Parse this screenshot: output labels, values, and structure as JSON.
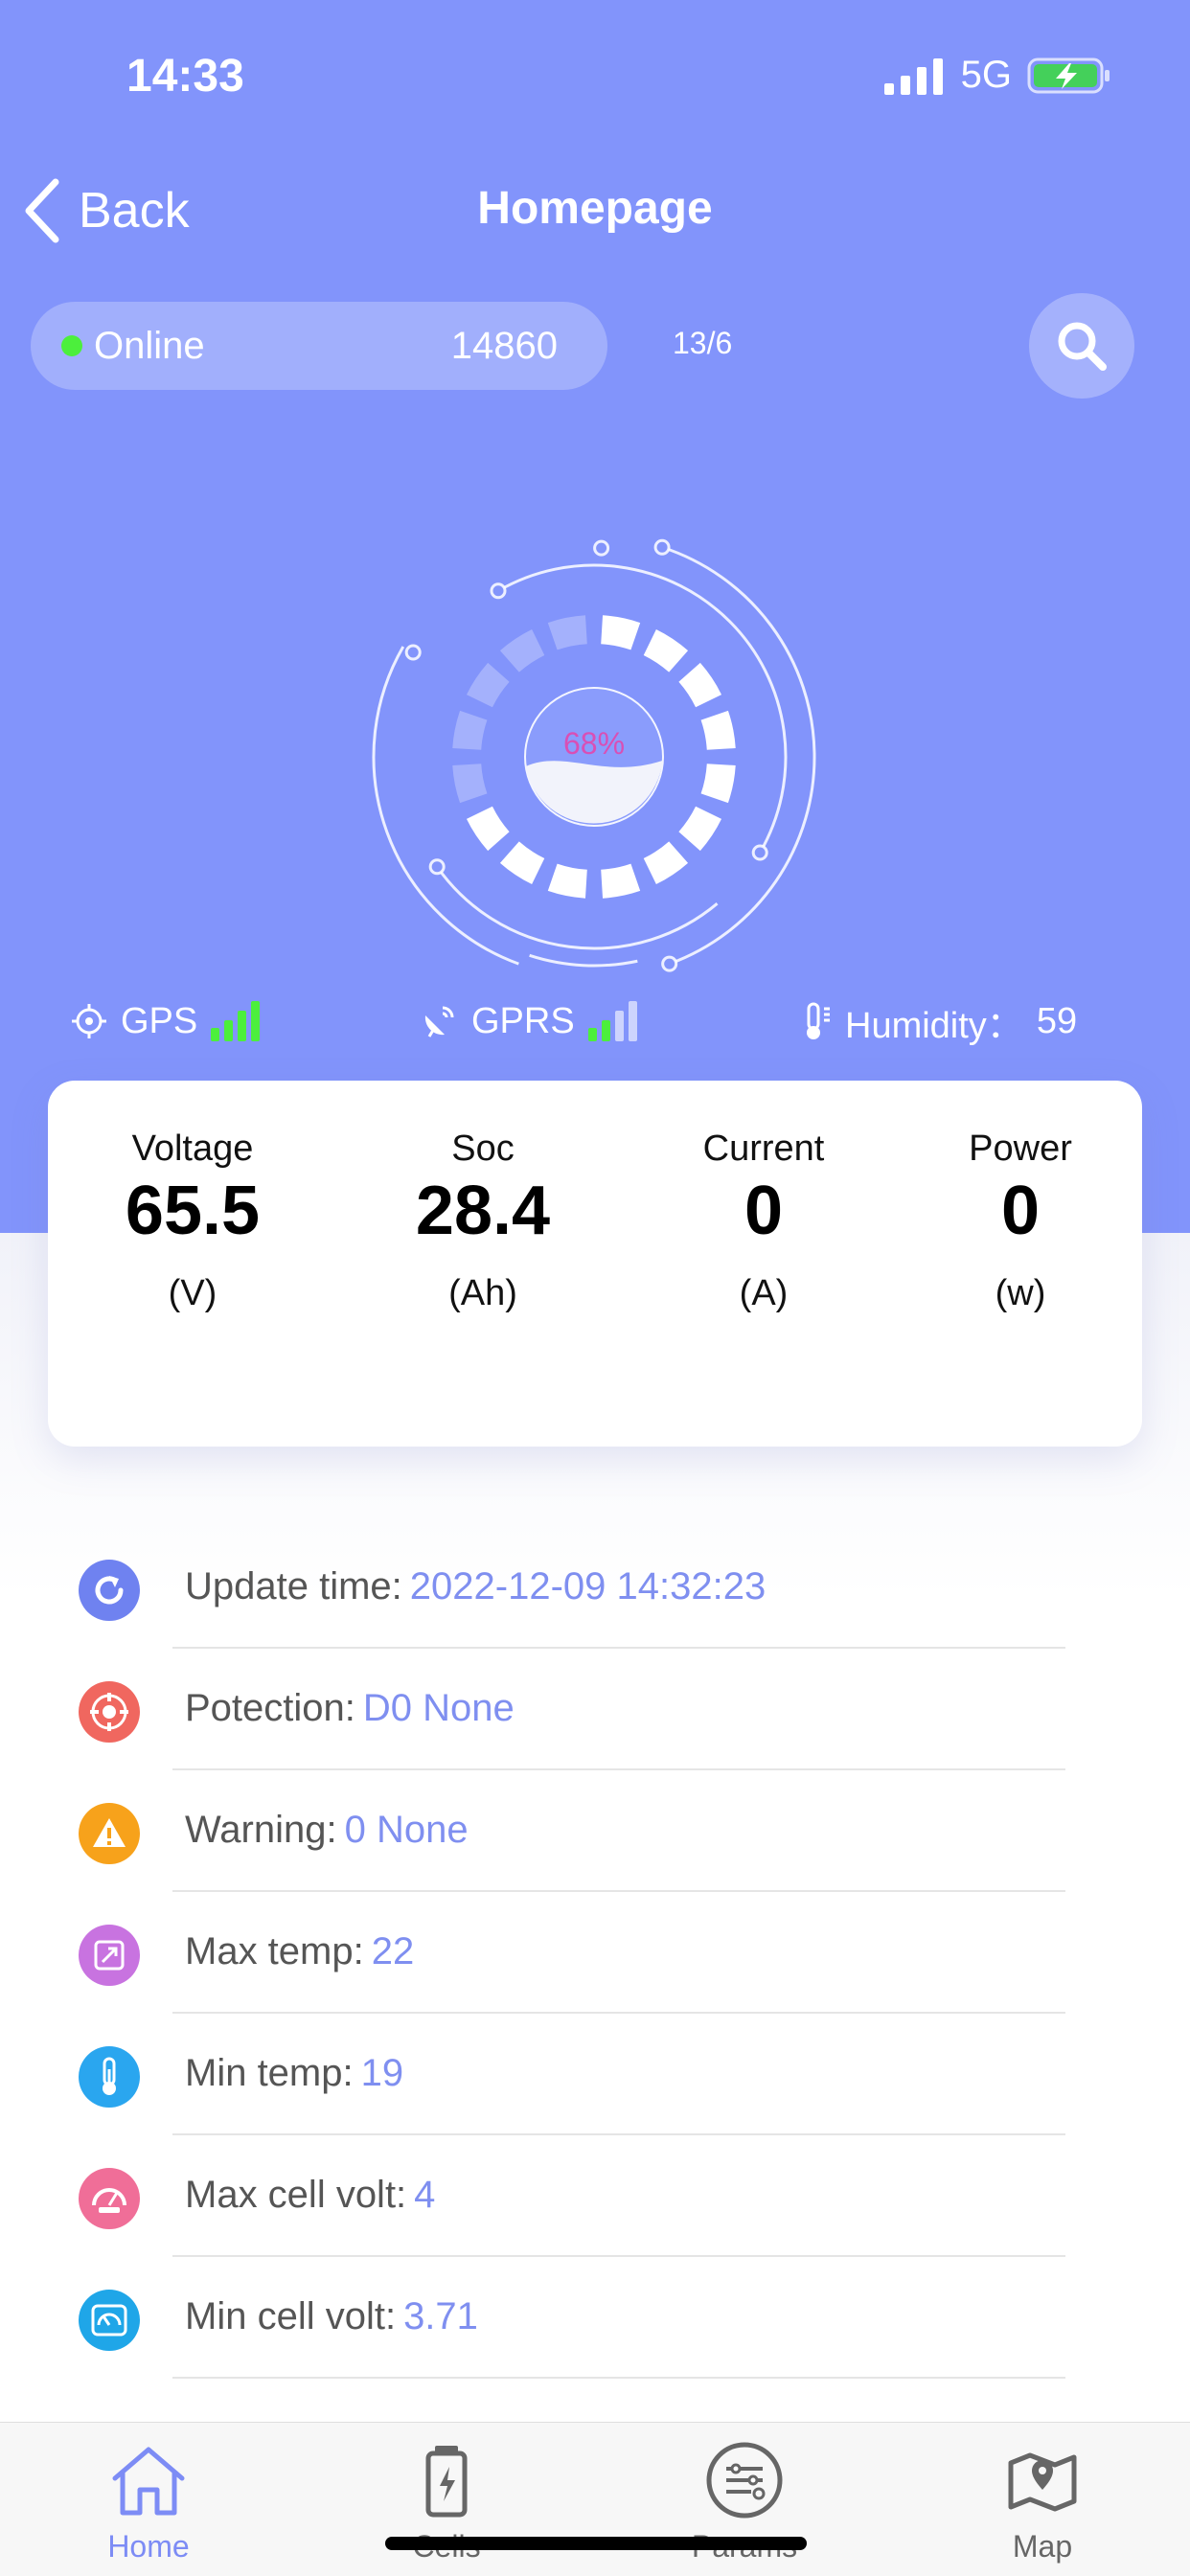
{
  "status_bar": {
    "time": "14:33",
    "network": "5G"
  },
  "nav": {
    "back_label": "Back",
    "title": "Homepage"
  },
  "device": {
    "status": "Online",
    "id": "14860",
    "count": "13/6"
  },
  "gauge": {
    "percent_label": "68%",
    "level": 0.68
  },
  "signals": {
    "gps_label": "GPS",
    "gps_strength": 4,
    "gprs_label": "GPRS",
    "gprs_strength": 2,
    "humidity_label": "Humidity：",
    "humidity_value": "59"
  },
  "metrics": [
    {
      "label": "Voltage",
      "value": "65.5",
      "unit": "(V)"
    },
    {
      "label": "Soc",
      "value": "28.4",
      "unit": "(Ah)"
    },
    {
      "label": "Current",
      "value": "0",
      "unit": "(A)"
    },
    {
      "label": "Power",
      "value": "0",
      "unit": "(w)"
    }
  ],
  "info": [
    {
      "label": "Update time:",
      "value": "2022-12-09 14:32:23",
      "icon": "refresh-icon",
      "color": "#6f82f0"
    },
    {
      "label": "Potection:",
      "value": "D0 None",
      "icon": "protection-icon",
      "color": "#f0675f"
    },
    {
      "label": "Warning:",
      "value": "0 None",
      "icon": "warning-icon",
      "color": "#f7a21b"
    },
    {
      "label": "Max temp:",
      "value": "22",
      "icon": "max-temp-icon",
      "color": "#c873e0"
    },
    {
      "label": "Min temp:",
      "value": "19",
      "icon": "thermometer-icon",
      "color": "#2aa6ef"
    },
    {
      "label": "Max cell volt:",
      "value": "4",
      "icon": "max-gauge-icon",
      "color": "#f06e98"
    },
    {
      "label": "Min cell volt:",
      "value": "3.71",
      "icon": "min-gauge-icon",
      "color": "#1fa6e8"
    }
  ],
  "tabs": [
    {
      "label": "Home",
      "icon": "home-icon",
      "active": true
    },
    {
      "label": "Cells",
      "icon": "battery-icon",
      "active": false
    },
    {
      "label": "Params",
      "icon": "sliders-icon",
      "active": false
    },
    {
      "label": "Map",
      "icon": "map-icon",
      "active": false
    }
  ],
  "colors": {
    "primary": "#8294fb",
    "accent_value": "#7f8ff0",
    "signal_green": "#4cef3c",
    "percent": "#d94fb5"
  }
}
